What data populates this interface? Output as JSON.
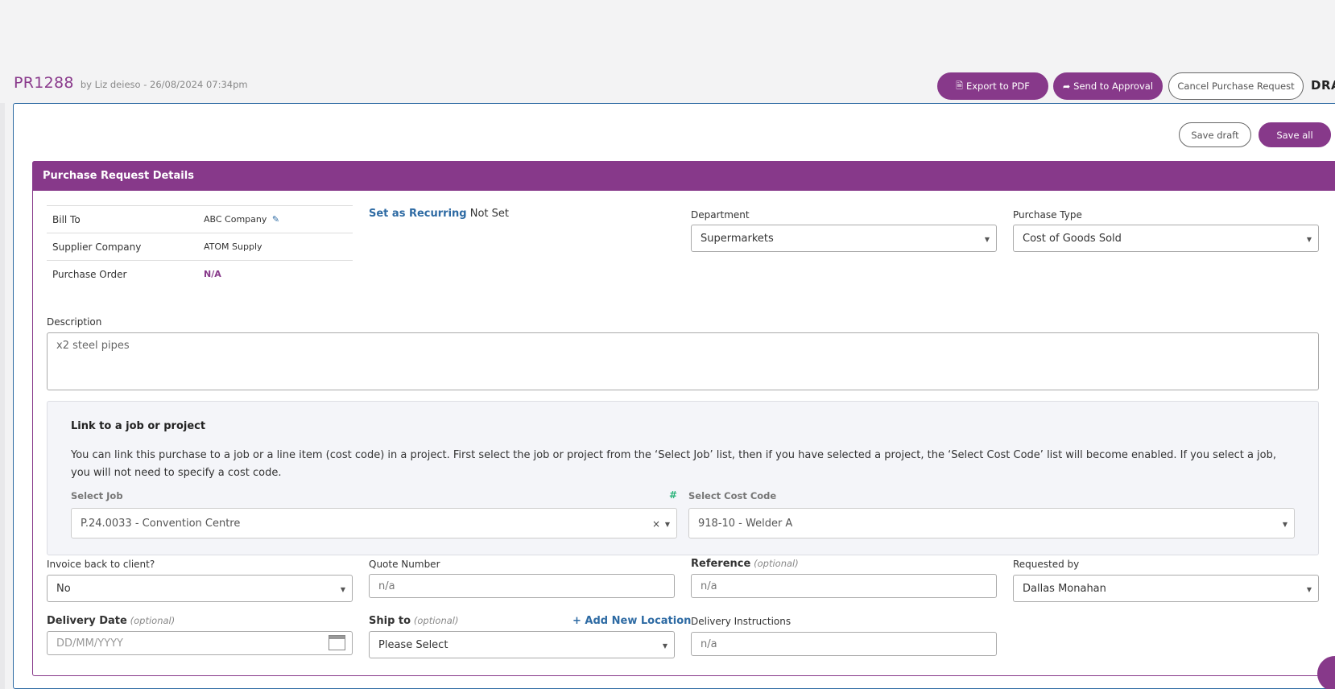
{
  "header": {
    "pr_id": "PR1288",
    "meta": "by Liz deieso - 26/08/2024 07:34pm",
    "status": "DRA"
  },
  "actions": {
    "export_label": "Export to PDF",
    "approval_label": "Send to Approval",
    "cancel_label": "Cancel Purchase Request",
    "save_draft_label": "Save draft",
    "save_all_label": "Save all"
  },
  "icons": {
    "export": "file-pdf-icon",
    "approval": "share-arrow-icon",
    "edit": "pencil-icon",
    "calendar": "calendar-icon"
  },
  "colors": {
    "brand": "#87398a",
    "link": "#2d6aa3",
    "accent_green": "#2bb37a"
  },
  "card": {
    "title": "Purchase Request Details",
    "bill_to_label": "Bill To",
    "bill_to_value": "ABC Company",
    "supplier_label": "Supplier Company",
    "supplier_value": "ATOM Supply",
    "po_label": "Purchase Order",
    "po_value": "N/A",
    "recurring_link": "Set as Recurring",
    "recurring_value": "Not Set",
    "department_label": "Department",
    "department_value": "Supermarkets",
    "purchase_type_label": "Purchase Type",
    "purchase_type_value": "Cost of Goods Sold",
    "description_label": "Description",
    "description_value": "x2 steel pipes"
  },
  "link_job": {
    "title": "Link to a job or project",
    "description": "You can link this purchase to a job or a line item (cost code) in a project. First select the job or project from the ‘Select Job’ list, then if you have selected a project, the ‘Select Cost Code’ list will become enabled. If you select a job, you will not need to specify a cost code.",
    "select_job_label": "Select Job",
    "hash": "#",
    "select_job_value": "P.24.0033 - Convention Centre",
    "select_cost_code_label": "Select Cost Code",
    "select_cost_code_value": "918-10 - Welder A"
  },
  "fields": {
    "invoice_label": "Invoice back to client?",
    "invoice_value": "No",
    "quote_label": "Quote Number",
    "quote_placeholder": "n/a",
    "reference_label": "Reference",
    "optional": "(optional)",
    "reference_placeholder": "n/a",
    "requested_by_label": "Requested by",
    "requested_by_value": "Dallas Monahan",
    "delivery_date_label": "Delivery Date",
    "delivery_date_placeholder": "DD/MM/YYYY",
    "ship_to_label": "Ship to",
    "add_location": "+ Add New Location",
    "ship_to_value": "Please Select",
    "delivery_instructions_label": "Delivery Instructions",
    "delivery_instructions_placeholder": "n/a"
  }
}
